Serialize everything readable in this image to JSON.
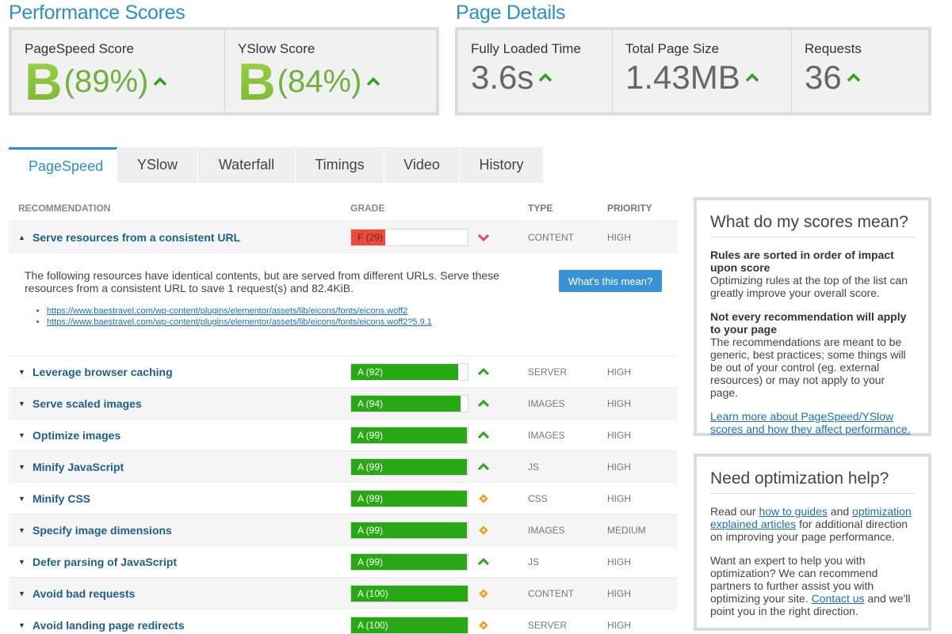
{
  "performance": {
    "title": "Performance Scores",
    "pagespeed_label": "PageSpeed Score",
    "pagespeed_grade": "B",
    "pagespeed_pct": "(89%)",
    "yslow_label": "YSlow Score",
    "yslow_grade": "B",
    "yslow_pct": "(84%)"
  },
  "details": {
    "title": "Page Details",
    "load_label": "Fully Loaded Time",
    "load_value": "3.6s",
    "size_label": "Total Page Size",
    "size_value": "1.43MB",
    "req_label": "Requests",
    "req_value": "36"
  },
  "tabs": [
    "PageSpeed",
    "YSlow",
    "Waterfall",
    "Timings",
    "Video",
    "History"
  ],
  "table": {
    "headers": {
      "rec": "RECOMMENDATION",
      "grade": "GRADE",
      "type": "TYPE",
      "priority": "PRIORITY"
    },
    "expanded": {
      "label": "Serve resources from a consistent URL",
      "grade": "F (29)",
      "grade_value": 29,
      "type": "CONTENT",
      "priority": "HIGH",
      "description": "The following resources have identical contents, but are served from different URLs. Serve these resources from a consistent URL to save 1 request(s) and 82.4KiB.",
      "button": "What's this mean?",
      "links": [
        "https://www.baestravel.com/wp-content/plugins/elementor/assets/lib/eicons/fonts/eicons.woff2",
        "https://www.baestravel.com/wp-content/plugins/elementor/assets/lib/eicons/fonts/eicons.woff2?5.9.1"
      ]
    },
    "rows": [
      {
        "label": "Leverage browser caching",
        "grade": "A (92)",
        "value": 92,
        "icon": "up-arrow-icon",
        "type": "SERVER",
        "priority": "HIGH"
      },
      {
        "label": "Serve scaled images",
        "grade": "A (94)",
        "value": 94,
        "icon": "up-arrow-icon",
        "type": "IMAGES",
        "priority": "HIGH"
      },
      {
        "label": "Optimize images",
        "grade": "A (99)",
        "value": 99,
        "icon": "up-arrow-icon",
        "type": "IMAGES",
        "priority": "HIGH"
      },
      {
        "label": "Minify JavaScript",
        "grade": "A (99)",
        "value": 99,
        "icon": "up-arrow-icon",
        "type": "JS",
        "priority": "HIGH"
      },
      {
        "label": "Minify CSS",
        "grade": "A (99)",
        "value": 99,
        "icon": "diamond-icon",
        "type": "CSS",
        "priority": "HIGH"
      },
      {
        "label": "Specify image dimensions",
        "grade": "A (99)",
        "value": 99,
        "icon": "diamond-icon",
        "type": "IMAGES",
        "priority": "MEDIUM"
      },
      {
        "label": "Defer parsing of JavaScript",
        "grade": "A (99)",
        "value": 99,
        "icon": "up-arrow-icon",
        "type": "JS",
        "priority": "HIGH"
      },
      {
        "label": "Avoid bad requests",
        "grade": "A (100)",
        "value": 100,
        "icon": "diamond-icon",
        "type": "CONTENT",
        "priority": "HIGH"
      },
      {
        "label": "Avoid landing page redirects",
        "grade": "A (100)",
        "value": 100,
        "icon": "diamond-icon",
        "type": "SERVER",
        "priority": "HIGH"
      }
    ]
  },
  "side1": {
    "title": "What do my scores mean?",
    "h1": "Rules are sorted in order of impact upon score",
    "p1": "Optimizing rules at the top of the list can greatly improve your overall score.",
    "h2": "Not every recommendation will apply to your page",
    "p2": "The recommendations are meant to be generic, best practices; some things will be out of your control (eg. external resources) or may not apply to your page.",
    "link": "Learn more about PageSpeed/YSlow scores and how they affect performance."
  },
  "side2": {
    "title": "Need optimization help?",
    "p1_a": "Read our ",
    "p1_link1": "how to guides",
    "p1_b": " and ",
    "p1_link2": "optimization explained articles",
    "p1_c": " for additional direction on improving your page performance.",
    "p2_a": "Want an expert to help you with optimization? We can recommend partners to further assist you with optimizing your site. ",
    "p2_link": "Contact us",
    "p2_b": " and we'll point you in the right direction."
  },
  "colors": {
    "accent": "#2a8fce",
    "good": "#28a815",
    "bad": "#e74c3c",
    "warn": "#f39c12"
  }
}
